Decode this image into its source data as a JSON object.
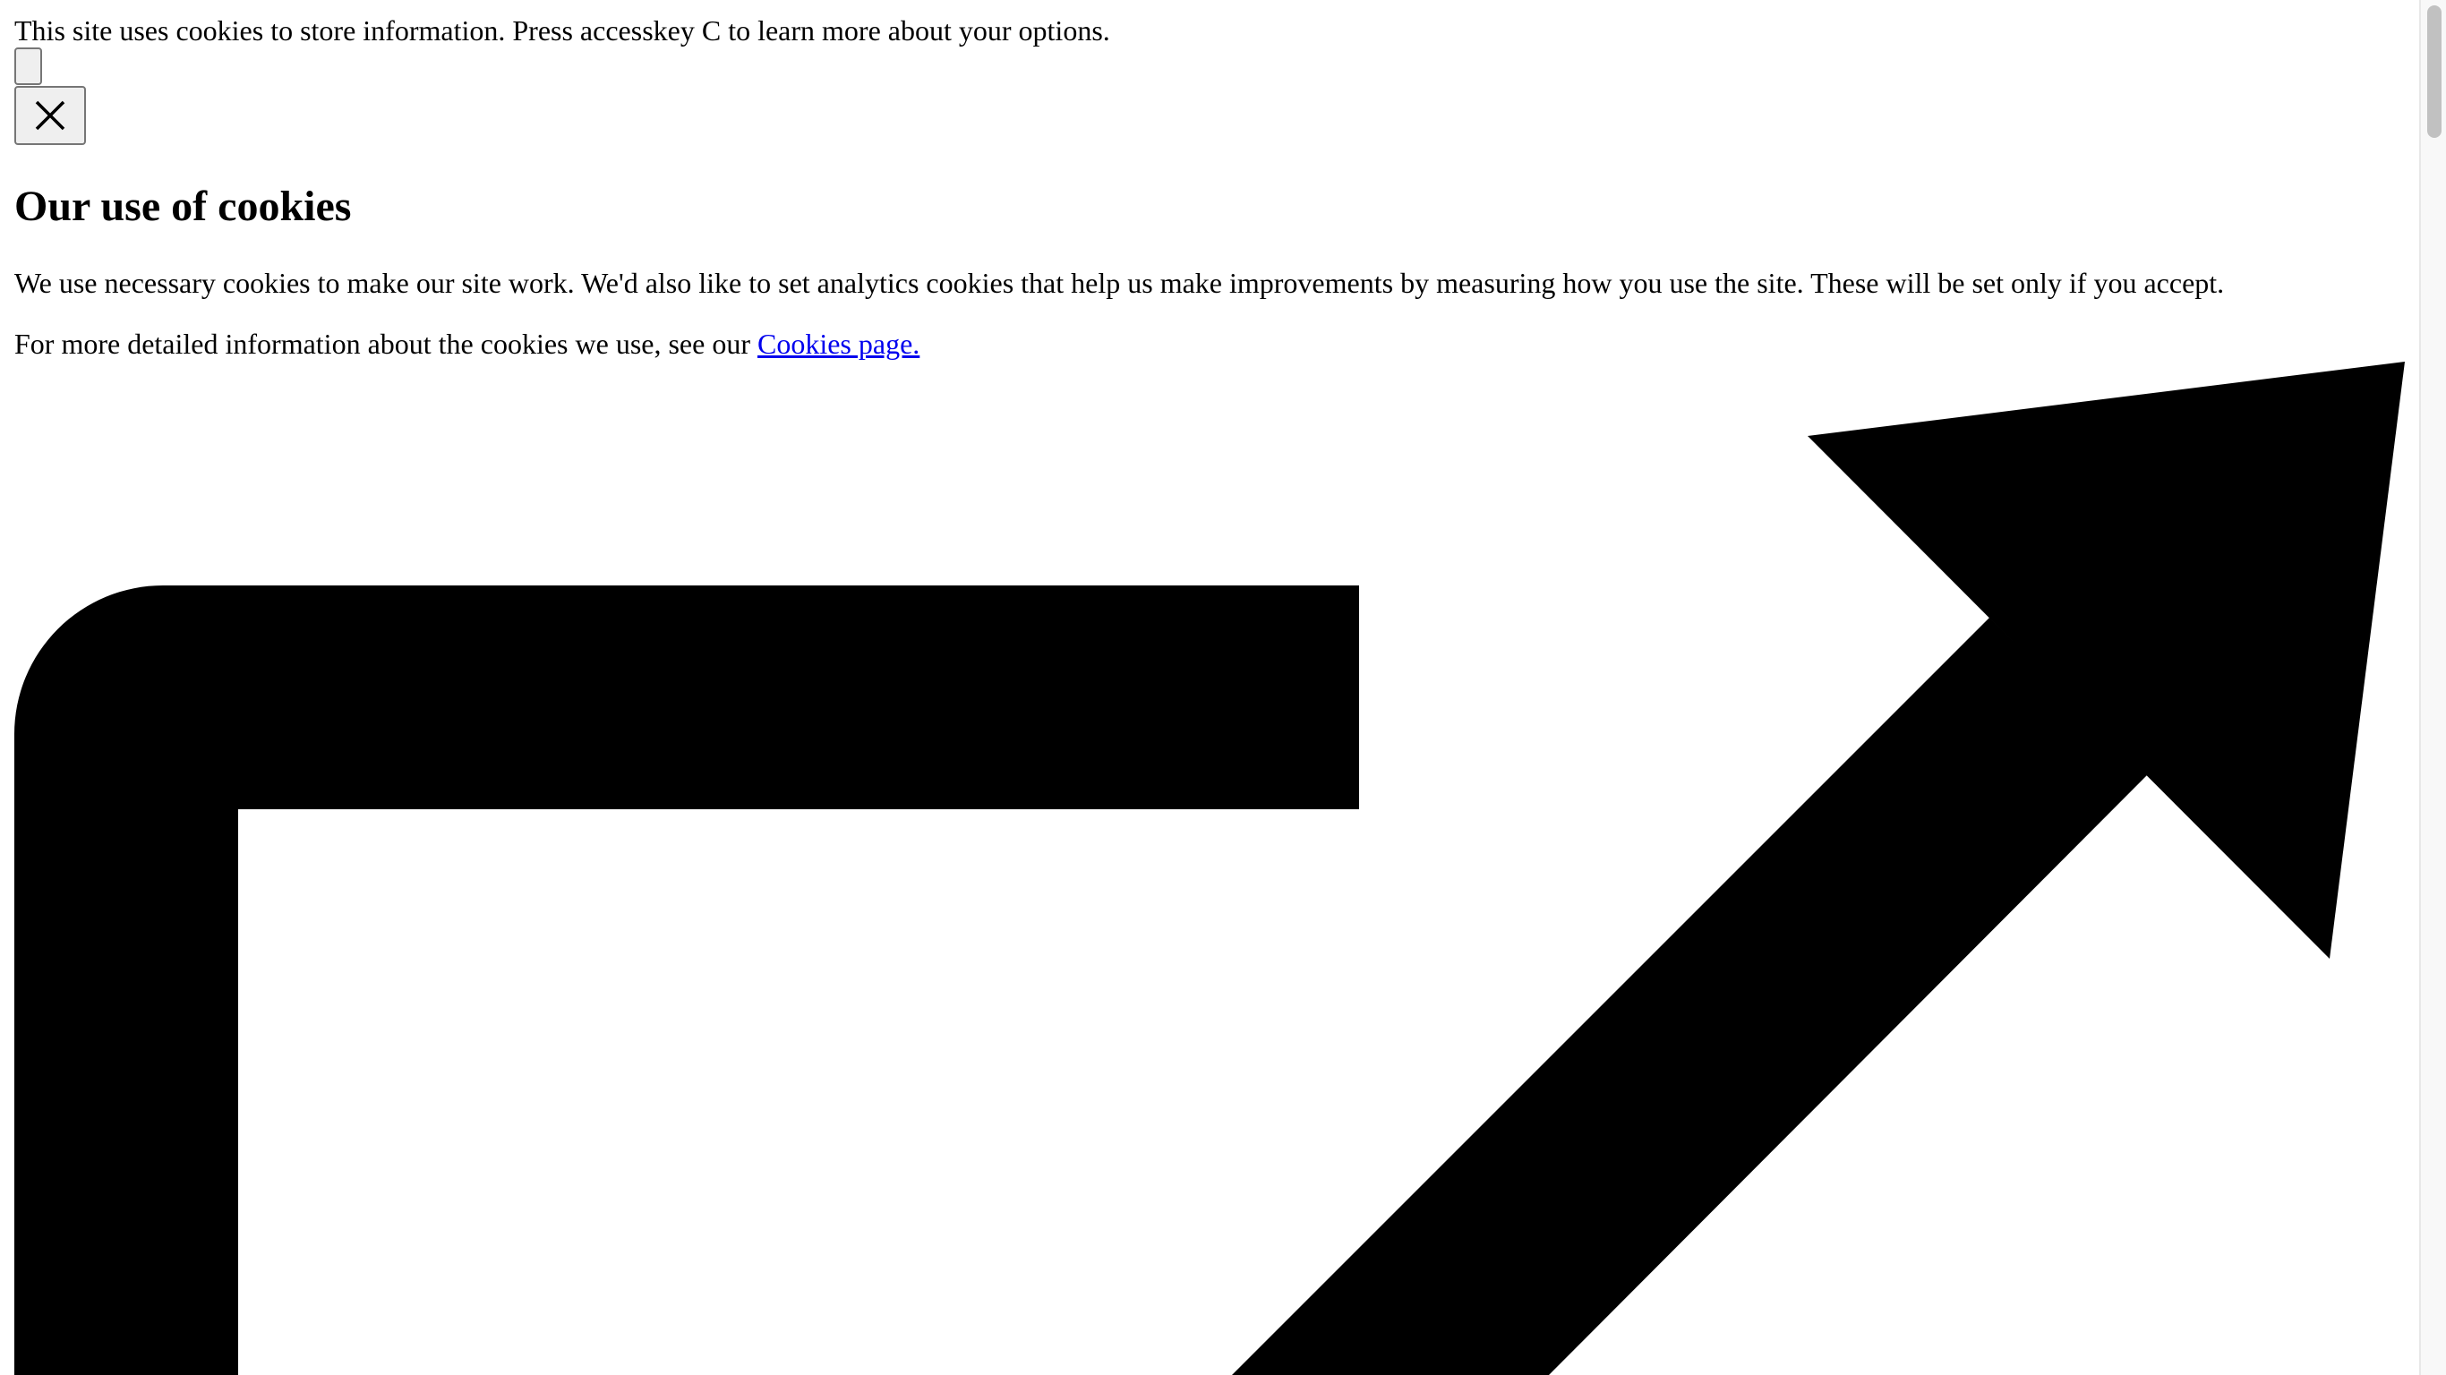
{
  "cookie_notice": {
    "text": "This site uses cookies to store information. Press accesskey C to learn more about your options."
  },
  "buttons": {
    "small_button_label": "",
    "close_icon": "close-icon"
  },
  "cookie_panel": {
    "heading": "Our use of cookies",
    "intro": "We use necessary cookies to make our site work. We'd also like to set analytics cookies that help us make improvements by measuring how you use the site. These will be set only if you accept.",
    "more_info_prefix": "For more detailed information about the cookies we use, see our ",
    "cookies_link": "Cookies page."
  },
  "icons": {
    "external_link": "external-link-icon"
  },
  "colors": {
    "link": "#0000ee",
    "button_bg": "#efefef",
    "scroll_thumb": "#c1c1c1"
  }
}
